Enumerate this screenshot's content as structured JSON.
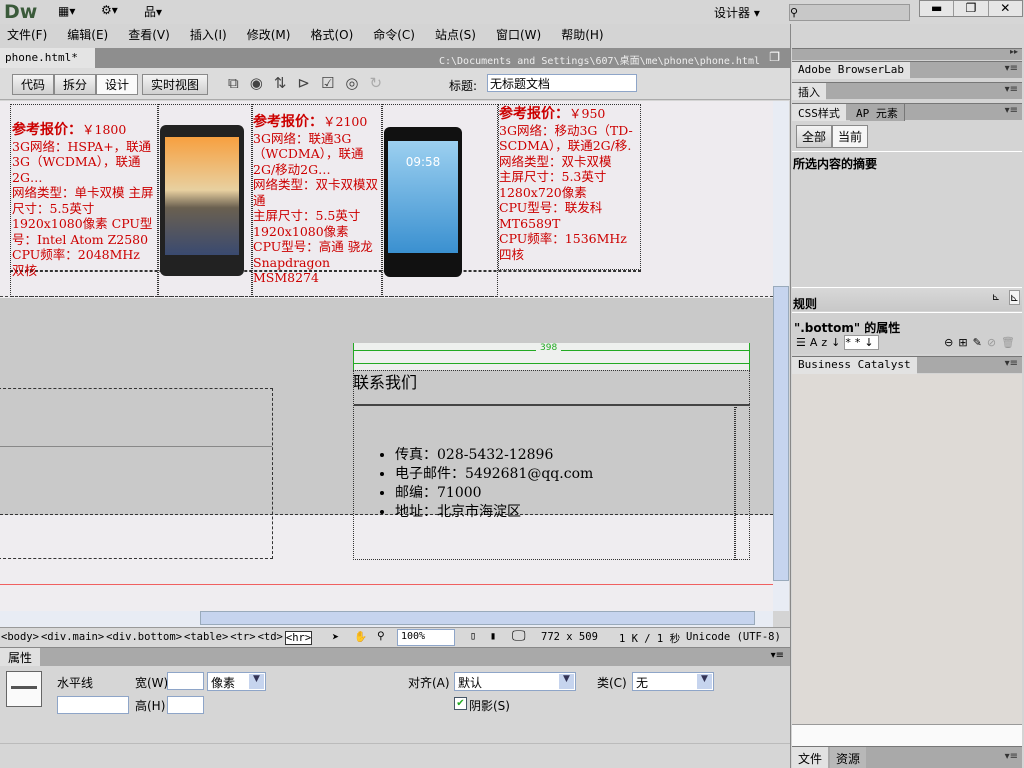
{
  "app": {
    "logo": "Dw",
    "workspace": "设计器",
    "search_placeholder": ""
  },
  "menu": [
    "文件(F)",
    "编辑(E)",
    "查看(V)",
    "插入(I)",
    "修改(M)",
    "格式(O)",
    "命令(C)",
    "站点(S)",
    "窗口(W)",
    "帮助(H)"
  ],
  "doc": {
    "tab": "phone.html*",
    "path": "C:\\Documents and Settings\\607\\桌面\\me\\phone\\phone.html"
  },
  "toolbar": {
    "views": [
      "代码",
      "拆分",
      "设计",
      "实时视图"
    ],
    "active_view": "设计",
    "title_label": "标题:",
    "title_value": "无标题文档"
  },
  "products": [
    {
      "price_label": "参考报价：",
      "price": "￥1800",
      "lines": [
        "3G网络：HSPA+，联通3G（WCDMA），联通2G…",
        "网络类型：单卡双模 主屏尺寸：5.5英寸 1920x1080像素 CPU型号：Intel Atom Z2580 CPU频率：2048MHz 双核"
      ]
    },
    {
      "price_label": "参考报价：",
      "price": "￥2100",
      "lines": [
        "3G网络：联通3G（WCDMA），联通2G/移动2G…",
        "网络类型：双卡双模双通",
        "主屏尺寸：5.5英寸 1920x1080像素",
        "CPU型号：高通 骁龙Snapdragon MSM8274"
      ]
    },
    {
      "price_label": "参考报价：",
      "price": "￥950",
      "lines": [
        "3G网络：移动3G（TD-SCDMA），联通2G/移.",
        "网络类型：双卡双模",
        "主屏尺寸：5.3英寸 1280x720像素",
        "CPU型号：联发科MT6589T",
        "CPU频率：1536MHz 四核"
      ]
    }
  ],
  "phone_screen_time": "09:58",
  "contact": {
    "width_marker": "398",
    "heading": "联系我们",
    "items": [
      "传真：028-5432-12896",
      "电子邮件：5492681@qq.com",
      "邮编：71000",
      "地址：北京市海淀区"
    ]
  },
  "status": {
    "tags": [
      "<body>",
      "<div.main>",
      "<div.bottom>",
      "<table>",
      "<tr>",
      "<td>",
      "<hr>"
    ],
    "zoom": "100%",
    "size": "772 x 509",
    "speed": "1 K / 1 秒",
    "encoding": "Unicode (UTF-8)"
  },
  "properties": {
    "title": "属性",
    "element": "水平线",
    "width_label": "宽(W)",
    "width_value": "",
    "unit": "像素",
    "height_label": "高(H)",
    "height_value": "",
    "align_label": "对齐(A)",
    "align_value": "默认",
    "class_label": "类(C)",
    "class_value": "无",
    "shade_label": "阴影(S)",
    "shade_checked": true
  },
  "panels": {
    "browserlab": "Adobe BrowserLab",
    "insert": "插入",
    "css_tab": "CSS样式",
    "ap_tab": "AP 元素",
    "all": "全部",
    "current": "当前",
    "summary": "所选内容的摘要",
    "rules": "规则",
    "props_of": "\".bottom\" 的属性",
    "bc": "Business Catalyst",
    "files": "文件",
    "assets": "资源"
  }
}
